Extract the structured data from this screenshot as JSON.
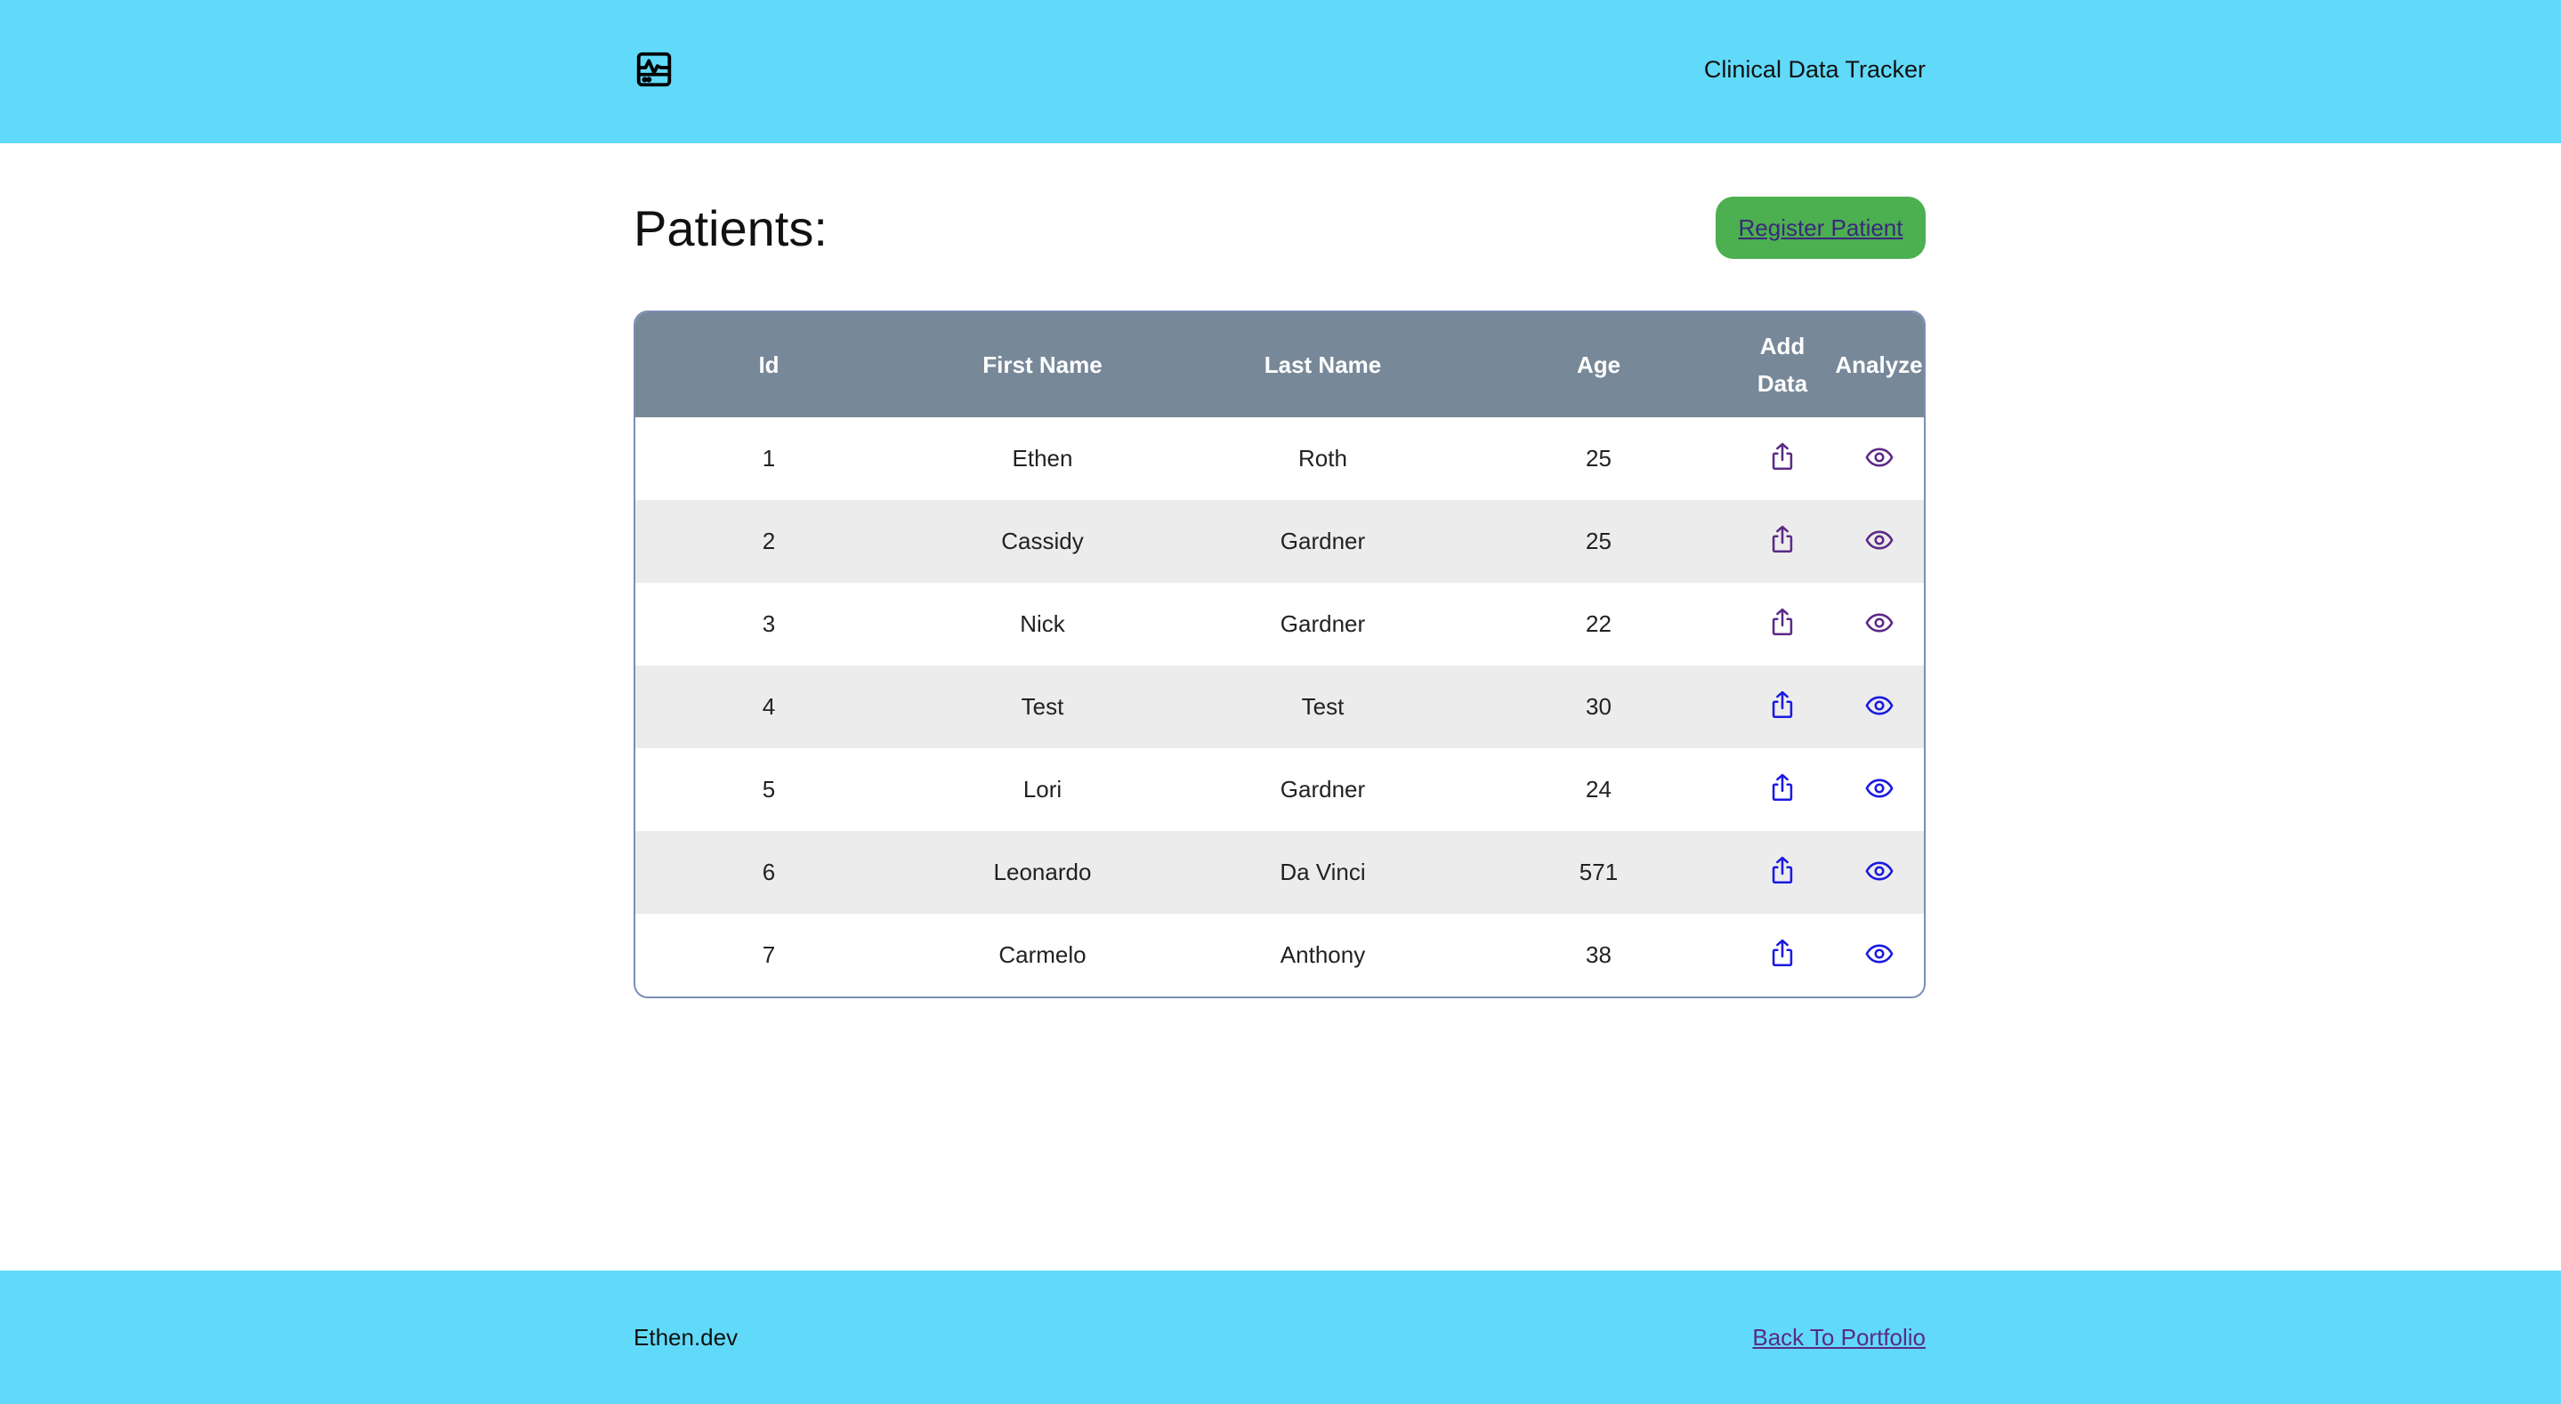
{
  "header": {
    "logo_icon": "monitor-chart-icon",
    "app_title": "Clinical Data Tracker"
  },
  "main": {
    "page_title": "Patients:",
    "register_label": "Register Patient"
  },
  "table": {
    "headers": {
      "id": "Id",
      "first_name": "First Name",
      "last_name": "Last Name",
      "age": "Age",
      "add_data_line1": "Add",
      "add_data_line2": "Data",
      "analyze": "Analyze"
    },
    "add_icon": "share-upload-icon",
    "analyze_icon": "eye-icon",
    "rows": [
      {
        "id": "1",
        "first": "Ethen",
        "last": "Roth",
        "age": "25"
      },
      {
        "id": "2",
        "first": "Cassidy",
        "last": "Gardner",
        "age": "25"
      },
      {
        "id": "3",
        "first": "Nick",
        "last": "Gardner",
        "age": "22"
      },
      {
        "id": "4",
        "first": "Test",
        "last": "Test",
        "age": "30"
      },
      {
        "id": "5",
        "first": "Lori",
        "last": "Gardner",
        "age": "24"
      },
      {
        "id": "6",
        "first": "Leonardo",
        "last": "Da Vinci",
        "age": "571"
      },
      {
        "id": "7",
        "first": "Carmelo",
        "last": "Anthony",
        "age": "38"
      }
    ]
  },
  "footer": {
    "brand": "Ethen.dev",
    "back_link": "Back To Portfolio"
  },
  "colors": {
    "header_bg": "#61daf9",
    "table_header_bg": "#778899",
    "register_bg": "#4caf50",
    "visited_link": "#5b2a86",
    "link": "#1a1ae0"
  }
}
